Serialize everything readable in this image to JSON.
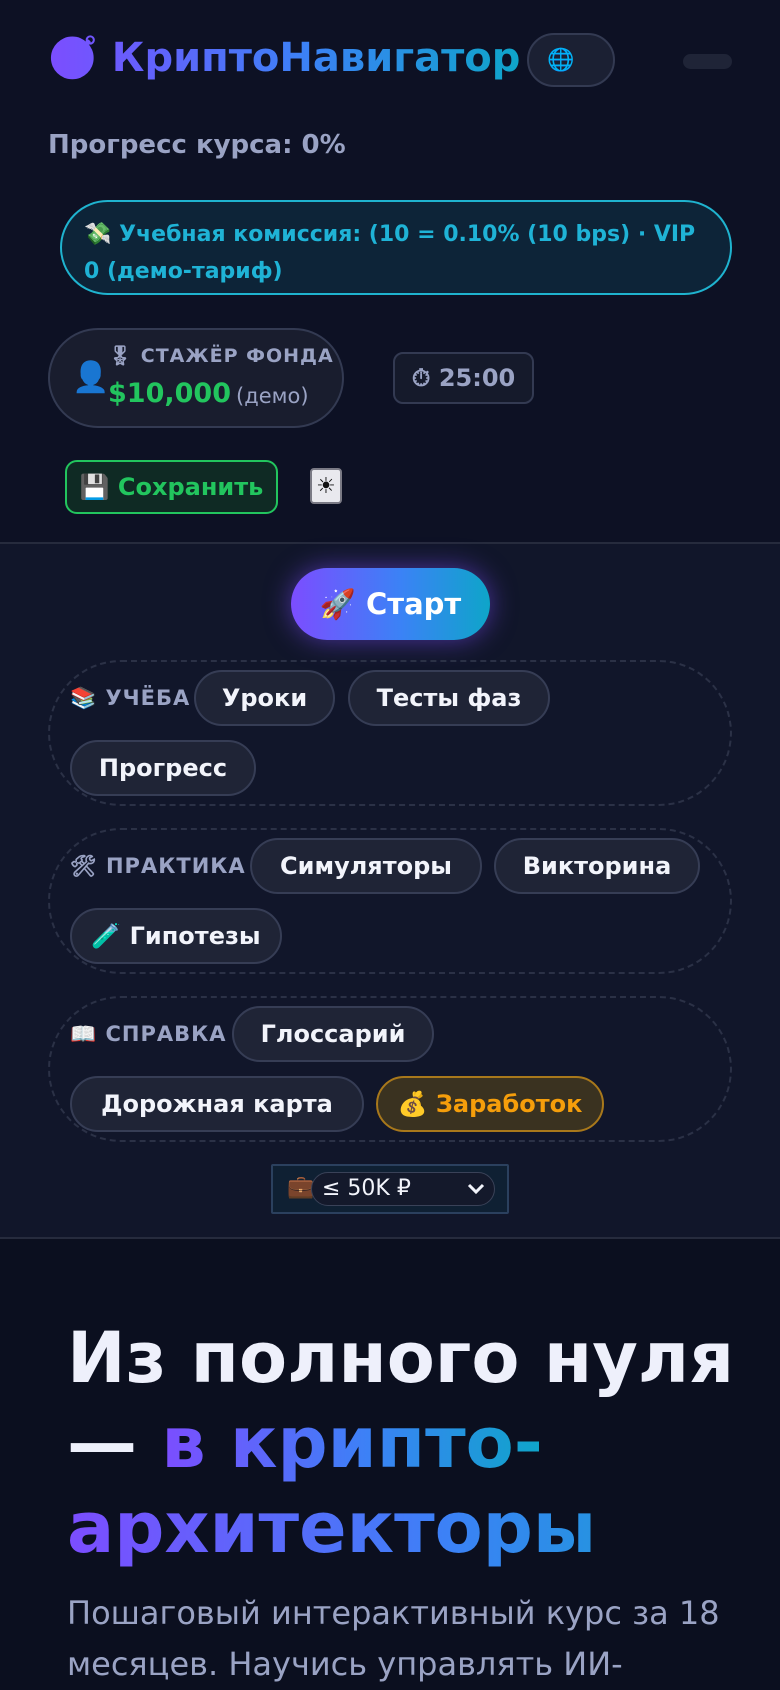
{
  "header": {
    "logo_icon": "🧭",
    "logo_text": "КриптоНавигатор",
    "lang_icon": "🌐",
    "progress_text": "Прогресс курса: 0%",
    "fee_icon": "💸",
    "fee_text": "Учебная комиссия: (10 = 0.10% (10 bps) · VIP 0 (демо-тариф)",
    "intern_icon": "👤",
    "intern_badge_icon": "🎖",
    "intern_label": "СТАЖЁР ФОНДА",
    "intern_amount": "$10,000",
    "intern_demo": "(демо)",
    "timer_icon": "⏱",
    "timer_value": "25:00",
    "save_icon": "💾",
    "save_label": "Сохранить",
    "theme_icon": "☀"
  },
  "nav": {
    "start_icon": "🚀",
    "start_label": "Старт",
    "groups": [
      {
        "icon": "📚",
        "label": "УЧЁБА",
        "items": [
          "Уроки",
          "Тесты фаз",
          "Прогресс"
        ]
      },
      {
        "icon": "🛠",
        "label": "ПРАКТИКА",
        "items": [
          "Симуляторы",
          "Викторина",
          "Гипотезы"
        ],
        "hyp_icon": "🧪"
      },
      {
        "icon": "📖",
        "label": "СПРАВКА",
        "items": [
          "Глоссарий",
          "Дорожная карта",
          "Заработок"
        ],
        "earn_icon": "💰"
      }
    ],
    "budget_icon": "💼",
    "budget_selected": "≤ 50K ₽"
  },
  "hero": {
    "title_part1": "Из полного нуля",
    "title_dash": "— ",
    "title_accent_1": "в крипто-",
    "title_accent_2": "архитекторы",
    "subtitle": "Пошаговый интерактивный курс за 18 месяцев. Научись управлять ИИ-"
  },
  "colors": {
    "accent_purple": "#7c4dff",
    "accent_blue": "#3b82f6",
    "accent_cyan": "#0ea5c9",
    "green": "#22c55e",
    "amber": "#f59e0b"
  }
}
